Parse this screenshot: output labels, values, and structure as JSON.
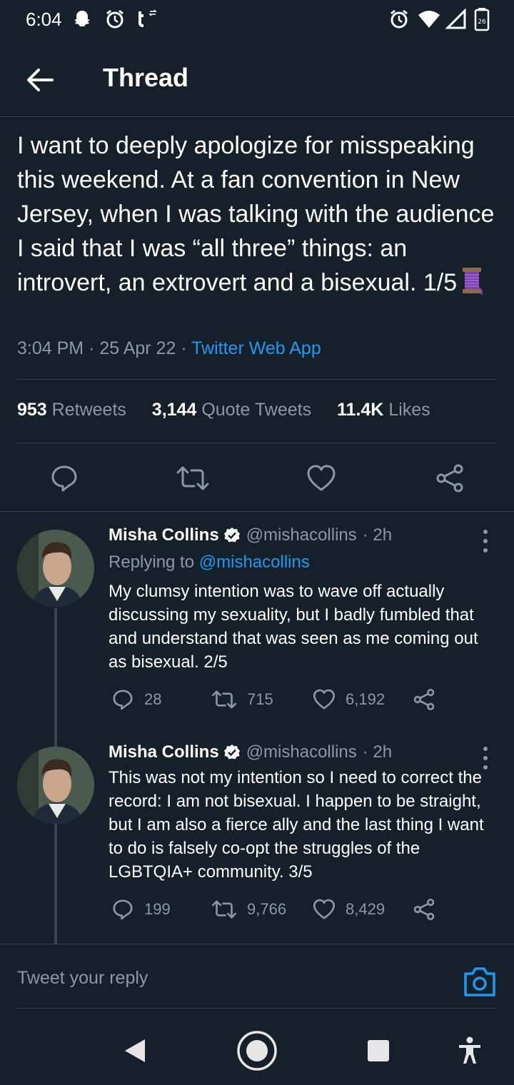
{
  "status_bar": {
    "time": "6:04",
    "left_icons": [
      "snapchat-icon",
      "alarm-icon",
      "tumblr-icon"
    ],
    "right_icons": [
      "alarm-icon",
      "wifi-icon",
      "signal-icon",
      "battery-icon"
    ],
    "battery": "26"
  },
  "header": {
    "title": "Thread",
    "back_icon": "arrow-left-icon"
  },
  "main_tweet": {
    "text": "I want to deeply apologize for misspeaking this weekend. At a fan convention in New Jersey, when I was talking with the audience I said that I was “all three” things: an introvert, an extrovert and a bisexual.  1/5",
    "emoji": "thread-spool-icon",
    "time": "3:04 PM",
    "date": "25 Apr 22",
    "source": "Twitter Web App",
    "retweets": "953",
    "retweets_label": "Retweets",
    "quotes": "3,144",
    "quotes_label": "Quote Tweets",
    "likes": "11.4K",
    "likes_label": "Likes"
  },
  "replies": [
    {
      "name": "Misha Collins",
      "handle": "@mishacollins",
      "age": "· 2h",
      "replying_prefix": "Replying to ",
      "replying_handle": "@mishacollins",
      "text": "My clumsy intention was to wave off actually discussing my sexuality, but I badly fumbled that and understand that was seen as me coming out as bisexual. 2/5",
      "replies": "28",
      "retweets": "715",
      "likes": "6,192"
    },
    {
      "name": "Misha Collins",
      "handle": "@mishacollins",
      "age": "· 2h",
      "text": "This was not my intention so I need to correct the record: I am not bisexual. I happen to be straight, but I am also a fierce ally and the last thing I want to do is falsely co-opt the struggles of the LGBTQIA+ community. 3/5",
      "replies": "199",
      "retweets": "9,766",
      "likes": "8,429"
    }
  ],
  "reply_box": {
    "placeholder": "Tweet your reply"
  },
  "colors": {
    "background": "#15202b",
    "accent": "#1d9bf0",
    "muted": "#8b98a5",
    "divider": "#38444d"
  }
}
